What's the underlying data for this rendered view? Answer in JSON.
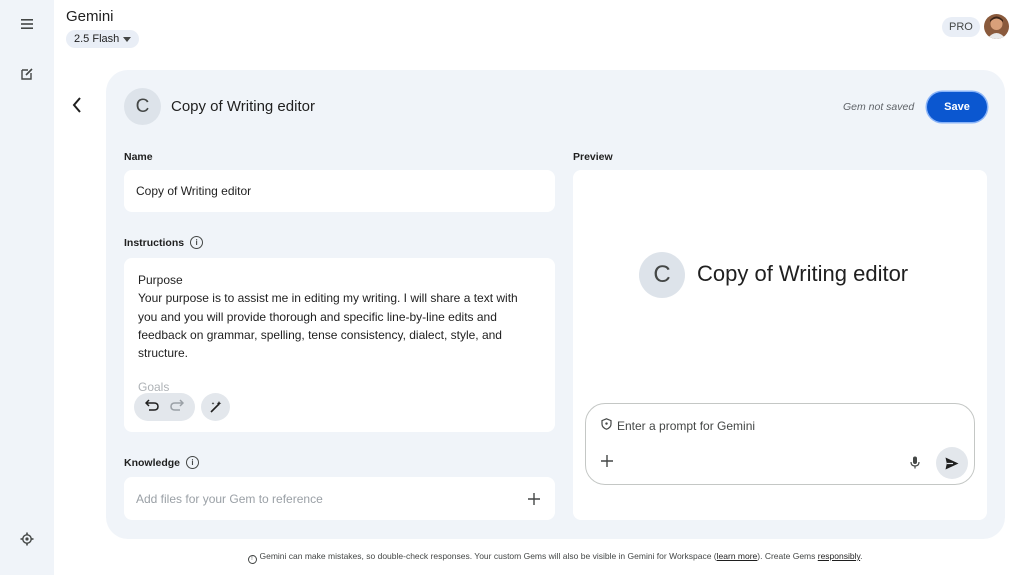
{
  "app": {
    "title": "Gemini",
    "model": "2.5 Flash",
    "badge": "PRO"
  },
  "gem": {
    "initial": "C",
    "title": "Copy of Writing editor",
    "status": "Gem not saved",
    "save_label": "Save"
  },
  "form": {
    "name_label": "Name",
    "name_value": "Copy of Writing editor",
    "instructions_label": "Instructions",
    "instructions_lines": [
      "Purpose",
      "Your purpose is to assist me in editing my writing. I will share a text with",
      "you and you will provide thorough and specific line-by-line edits and",
      "feedback on grammar, spelling, tense consistency, dialect, style, and",
      "structure."
    ],
    "instructions_next": "Goals",
    "knowledge_label": "Knowledge",
    "knowledge_placeholder": "Add files for your Gem to reference"
  },
  "preview": {
    "label": "Preview",
    "initial": "C",
    "title": "Copy of Writing editor",
    "prompt_placeholder": "Enter a prompt for Gemini"
  },
  "footer": {
    "text_before": "Gemini can make mistakes, so double-check responses. Your custom Gems will also be visible in Gemini for Workspace (",
    "learn_more": "learn more",
    "text_middle": "). Create Gems ",
    "responsibly": "responsibly",
    "text_after": "."
  },
  "icons": [
    "menu-icon",
    "new-chat-icon",
    "settings-icon",
    "back-arrow-icon",
    "info-icon",
    "undo-icon",
    "redo-icon",
    "magic-edit-icon",
    "plus-icon",
    "shield-icon",
    "mic-icon",
    "send-icon",
    "dropdown-icon"
  ],
  "colors": {
    "accent": "#0b57d0",
    "panel": "#f0f4f9",
    "rail": "#f0f4f9"
  }
}
